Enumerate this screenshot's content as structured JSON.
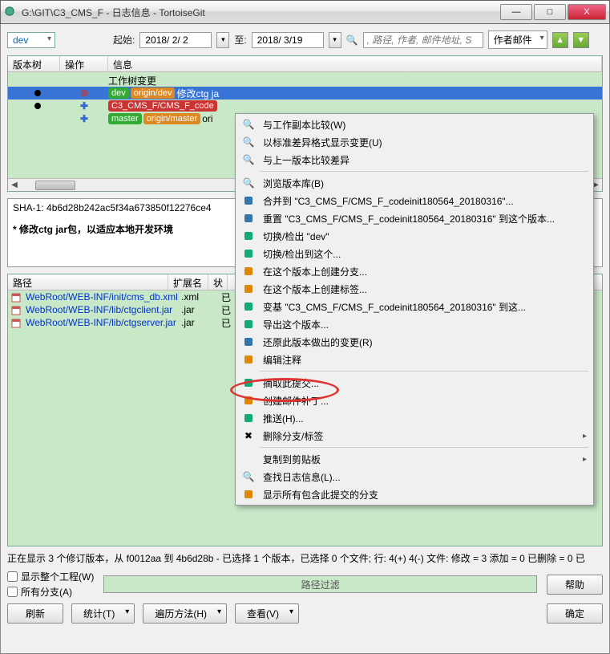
{
  "window": {
    "title": "G:\\GIT\\C3_CMS_F - 日志信息 - TortoiseGit",
    "min": "—",
    "max": "□",
    "close": "X"
  },
  "top": {
    "branch": "dev",
    "from_label": "起始:",
    "from_date": "2018/ 2/ 2",
    "to_label": "至:",
    "to_date": "2018/ 3/19",
    "search_placeholder": ", 路径, 作者, 邮件地址, S",
    "author_field": "作者邮件"
  },
  "log": {
    "headers": {
      "tree": "版本树",
      "op": "操作",
      "msg": "信息"
    },
    "rows": [
      {
        "msg": "工作树变更",
        "tags": []
      },
      {
        "msg_prefix_tags": [
          {
            "cls": "green",
            "text": "dev"
          },
          {
            "cls": "orange",
            "text": "origin/dev"
          }
        ],
        "msg": "修改ctg ja",
        "selected": true,
        "op_icon": "exclaim-red"
      },
      {
        "msg_prefix_tags": [
          {
            "cls": "red",
            "text": "C3_CMS_F/CMS_F_code"
          }
        ],
        "msg": "",
        "op_icon": "plus-blue"
      },
      {
        "msg_prefix_tags": [
          {
            "cls": "green",
            "text": "master"
          },
          {
            "cls": "orange",
            "text": "origin/master"
          }
        ],
        "msg": "ori",
        "op_icon": "plus-blue"
      }
    ]
  },
  "detail": {
    "sha_label": "SHA-1:",
    "sha": "4b6d28b242ac5f34a673850f12276ce4",
    "message": "* 修改ctg jar包，以适应本地开发环境"
  },
  "files": {
    "headers": {
      "path": "路径",
      "ext": "扩展名",
      "st": "状"
    },
    "rows": [
      {
        "name": "WebRoot/WEB-INF/init/cms_db.xml",
        "ext": ".xml",
        "st": "已"
      },
      {
        "name": "WebRoot/WEB-INF/lib/ctgclient.jar",
        "ext": ".jar",
        "st": "已"
      },
      {
        "name": "WebRoot/WEB-INF/lib/ctgserver.jar",
        "ext": ".jar",
        "st": "已"
      }
    ]
  },
  "context_menu": {
    "items": [
      {
        "icon": "🔍",
        "label": "与工作副本比较(W)"
      },
      {
        "icon": "🔍",
        "label": "以标准差异格式显示变更(U)"
      },
      {
        "icon": "🔍",
        "label": "与上一版本比较差异"
      },
      {
        "sep": true
      },
      {
        "icon": "🔍",
        "label": "浏览版本库(B)"
      },
      {
        "icon_svg": "merge",
        "label": "合并到 \"C3_CMS_F/CMS_F_codeinit180564_20180316\"..."
      },
      {
        "icon_svg": "reset",
        "label": "重置 \"C3_CMS_F/CMS_F_codeinit180564_20180316\" 到这个版本..."
      },
      {
        "icon_svg": "switch",
        "label": "切换/检出 \"dev\""
      },
      {
        "icon_svg": "switch",
        "label": "切换/检出到这个..."
      },
      {
        "icon_svg": "branch",
        "label": "在这个版本上创建分支..."
      },
      {
        "icon_svg": "tag",
        "label": "在这个版本上创建标签..."
      },
      {
        "icon_svg": "rebase",
        "label": "变基 \"C3_CMS_F/CMS_F_codeinit180564_20180316\" 到这..."
      },
      {
        "icon_svg": "export",
        "label": "导出这个版本..."
      },
      {
        "icon_svg": "revert",
        "label": "还原此版本做出的变更(R)"
      },
      {
        "icon_svg": "edit",
        "label": "编辑注释"
      },
      {
        "sep": true
      },
      {
        "icon_svg": "cherry",
        "label": "摘取此提交...",
        "highlighted": true
      },
      {
        "icon_svg": "patch",
        "label": "创建邮件补丁..."
      },
      {
        "icon_svg": "push",
        "label": "推送(H)..."
      },
      {
        "icon": "✖",
        "label": "删除分支/标签",
        "sub": true
      },
      {
        "sep": true
      },
      {
        "icon": "",
        "label": "复制到剪贴板",
        "sub": true
      },
      {
        "icon": "🔍",
        "label": "查找日志信息(L)..."
      },
      {
        "icon_svg": "branch",
        "label": "显示所有包含此提交的分支"
      }
    ]
  },
  "status": "正在显示 3 个修订版本，从 f0012aa 到 4b6d28b - 已选择 1 个版本，已选择 0 个文件; 行: 4(+) 4(-) 文件: 修改 = 3 添加 = 0 已删除 = 0 已",
  "bottom": {
    "chk1": "显示整个工程(W)",
    "chk2": "所有分支(A)",
    "path_filter": "路径过滤",
    "help": "帮助",
    "refresh": "刷新",
    "stats": "统计(T)",
    "walk": "遍历方法(H)",
    "view": "查看(V)",
    "ok": "确定"
  }
}
